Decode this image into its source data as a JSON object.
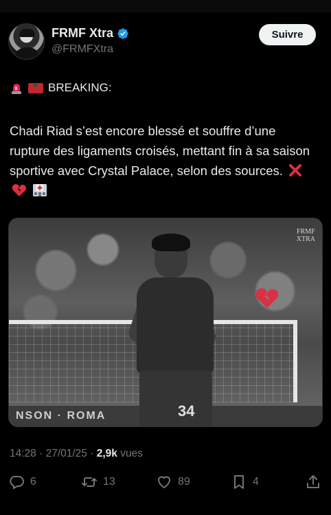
{
  "account": {
    "display_name": "FRMF Xtra",
    "handle": "@FRMFXtra",
    "follow_label": "Suivre"
  },
  "tweet": {
    "breaking": "BREAKING:",
    "body": "Chadi Riad s’est encore blessé et souffre d’une rupture des ligaments croisés, mettant fin à sa saison sportive avec Crystal Palace, selon des sources."
  },
  "media": {
    "watermark_line1": "FRMF",
    "watermark_line2": "XTRA",
    "jersey_number": "34",
    "board_text": "NSON · ROMA"
  },
  "meta": {
    "time": "14:28",
    "date": "27/01/25",
    "views_count": "2,9k",
    "views_label": "vues"
  },
  "stats": {
    "replies": "6",
    "reposts": "13",
    "likes": "89",
    "bookmarks": "4"
  },
  "colors": {
    "background": "#000000",
    "text": "#e7e9ea",
    "muted": "#71767b",
    "verified": "#1d9bf0"
  }
}
